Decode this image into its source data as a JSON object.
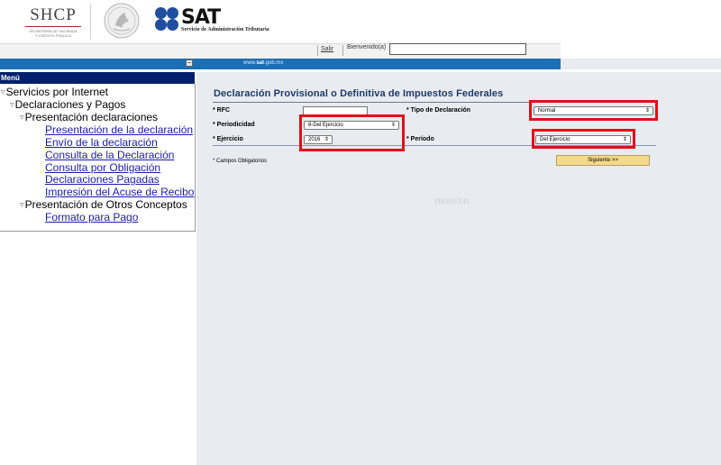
{
  "header": {
    "shcp_acronym": "SHCP",
    "shcp_line1": "SECRETARÍA DE HACIENDA",
    "shcp_line2": "Y CRÉDITO PÚBLICO",
    "sat_acronym": "SAT",
    "sat_full_name": "Servicio de Administración Tributaria"
  },
  "loginbar": {
    "salir_label": "Salir",
    "bienvenido_label": "Bienvenido(a)",
    "user_value": ""
  },
  "bluebar": {
    "url_prefix": "www.",
    "url_bold": "sat",
    "url_suffix": ".gob.mx"
  },
  "menu": {
    "title": "Menú",
    "minimize_symbol": "–",
    "items": [
      {
        "label": "Servicios por Internet"
      },
      {
        "label": "Declaraciones y Pagos"
      },
      {
        "label": "Presentación declaraciones"
      },
      {
        "label": "Presentación de la declaración"
      },
      {
        "label": "Envío de la declaración"
      },
      {
        "label": "Consulta de la Declaración"
      },
      {
        "label": "Consulta por Obligación"
      },
      {
        "label": "Declaraciones Pagadas"
      },
      {
        "label": "Impresión del Acuse de Recibo"
      },
      {
        "label": "Presentación de Otros Conceptos"
      },
      {
        "label": "Formato para Pago"
      }
    ]
  },
  "form": {
    "title": "Declaración Provisional o Definitiva de Impuestos Federales",
    "rfc_label": "* RFC",
    "rfc_value": "",
    "tipo_label": "* Tipo de Declaración",
    "tipo_value": "Normal",
    "periodicidad_label": "* Periodicidad",
    "periodicidad_value": "8-Del Ejercicio",
    "ejercicio_label": "* Ejercicio",
    "ejercicio_value": "2016",
    "periodo_label": "* Período",
    "periodo_value": "Del Ejercicio",
    "obligatorios_note": "* Campos Obligatorios",
    "siguiente_label": "Siguiente >>",
    "watermark": "PROBSX41",
    "select_arrow": "⇕"
  },
  "colors": {
    "highlight": "#e01018",
    "bluebar": "#1a6fb5",
    "menu_header": "#001f6c",
    "content_bg": "#e8ebf0",
    "title_text": "#1d3b6a",
    "link": "#1b1bb0"
  },
  "icons": [
    "mexican-seal-icon",
    "sat-circles-icon",
    "tree-triangle-icon",
    "minimize-icon"
  ]
}
